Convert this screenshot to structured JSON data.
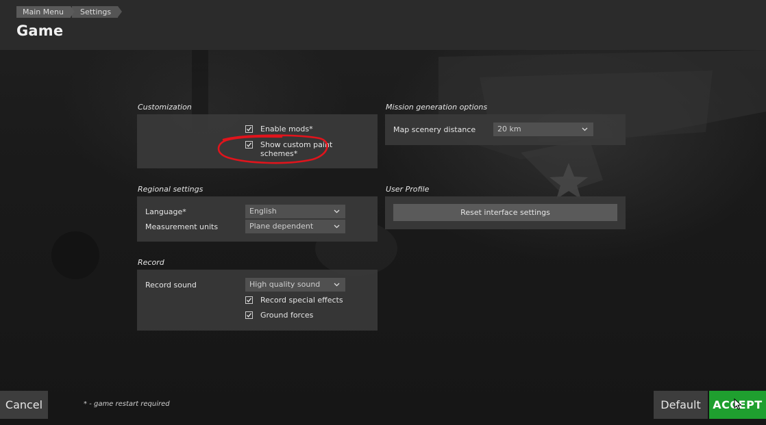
{
  "breadcrumb": {
    "items": [
      "Main Menu",
      "Settings"
    ]
  },
  "page": {
    "title": "Game"
  },
  "customization": {
    "title": "Customization",
    "enable_mods": {
      "label": "Enable mods*",
      "checked": true
    },
    "custom_paint": {
      "label_line1": "Show custom paint",
      "label_line2": "schemes*",
      "checked": true
    }
  },
  "mission": {
    "title": "Mission generation options",
    "scenery_label": "Map scenery distance",
    "scenery_value": "20 km"
  },
  "regional": {
    "title": "Regional settings",
    "language_label": "Language*",
    "language_value": "English",
    "units_label": "Measurement units",
    "units_value": "Plane dependent"
  },
  "user_profile": {
    "title": "User Profile",
    "reset_label": "Reset interface settings"
  },
  "record": {
    "title": "Record",
    "sound_label": "Record sound",
    "sound_value": "High quality sound",
    "special_effects": {
      "label": "Record special effects",
      "checked": true
    },
    "ground_forces": {
      "label": "Ground forces",
      "checked": true
    }
  },
  "footer": {
    "footnote": "* - game restart required",
    "cancel_label": "Cancel",
    "default_label": "Default",
    "accept_label": "ACCEPT"
  },
  "colors": {
    "accent_green": "#1f9f2f",
    "annotation_red": "#e0141c",
    "panel_bg": "#3a3a3a"
  },
  "icons": [
    "checkbox-check-icon",
    "chevron-down-icon",
    "cursor-icon"
  ]
}
